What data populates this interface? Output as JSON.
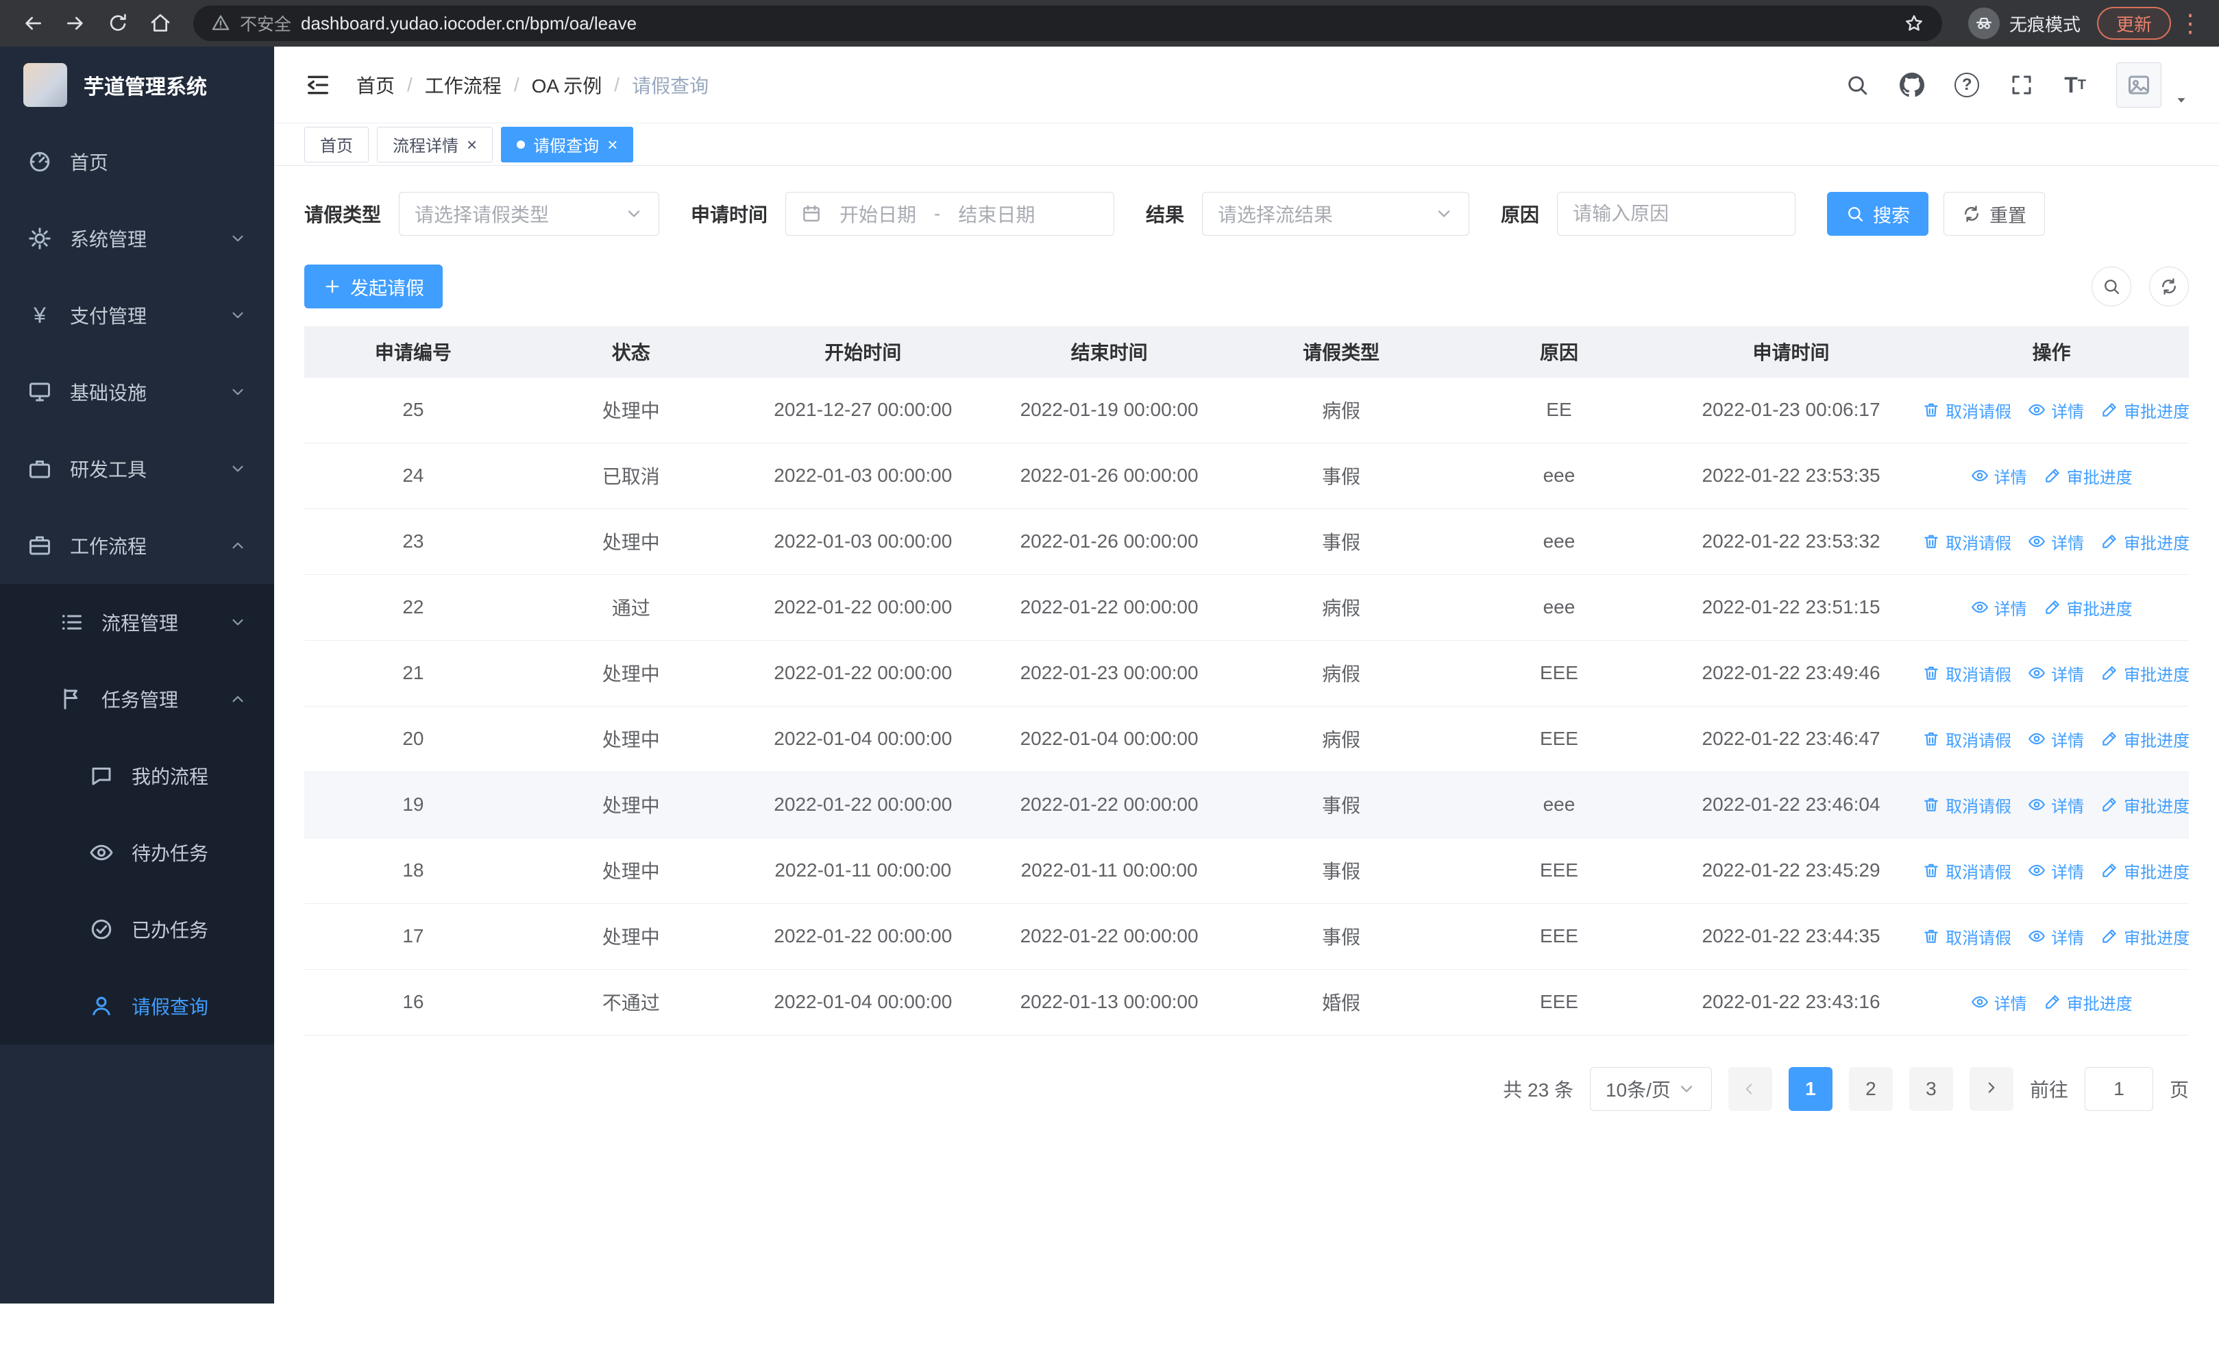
{
  "browser": {
    "security_warning": "不安全",
    "url": "dashboard.yudao.iocoder.cn/bpm/oa/leave",
    "incognito_label": "无痕模式",
    "update_label": "更新"
  },
  "sidebar": {
    "logo_title": "芋道管理系统",
    "items": [
      {
        "label": "首页"
      },
      {
        "label": "系统管理"
      },
      {
        "label": "支付管理"
      },
      {
        "label": "基础设施"
      },
      {
        "label": "研发工具"
      },
      {
        "label": "工作流程"
      },
      {
        "label": "流程管理"
      },
      {
        "label": "任务管理"
      },
      {
        "label": "我的流程"
      },
      {
        "label": "待办任务"
      },
      {
        "label": "已办任务"
      },
      {
        "label": "请假查询"
      }
    ]
  },
  "breadcrumb": {
    "items": [
      "首页",
      "工作流程",
      "OA 示例",
      "请假查询"
    ]
  },
  "tabs": [
    {
      "label": "首页"
    },
    {
      "label": "流程详情"
    },
    {
      "label": "请假查询"
    }
  ],
  "filters": {
    "leave_type_label": "请假类型",
    "leave_type_placeholder": "请选择请假类型",
    "apply_time_label": "申请时间",
    "start_date_placeholder": "开始日期",
    "range_separator": "-",
    "end_date_placeholder": "结束日期",
    "result_label": "结果",
    "result_placeholder": "请选择流结果",
    "reason_label": "原因",
    "reason_placeholder": "请输入原因",
    "search_label": "搜索",
    "reset_label": "重置"
  },
  "toolbar": {
    "create_label": "发起请假"
  },
  "table": {
    "columns": [
      "申请编号",
      "状态",
      "开始时间",
      "结束时间",
      "请假类型",
      "原因",
      "申请时间",
      "操作"
    ],
    "actions": {
      "cancel": "取消请假",
      "detail": "详情",
      "progress": "审批进度"
    },
    "rows": [
      {
        "id": "25",
        "status": "处理中",
        "start": "2021-12-27 00:00:00",
        "end": "2022-01-19 00:00:00",
        "type": "病假",
        "reason": "EE",
        "applied": "2022-01-23 00:06:17",
        "cancelable": true,
        "hover": false
      },
      {
        "id": "24",
        "status": "已取消",
        "start": "2022-01-03 00:00:00",
        "end": "2022-01-26 00:00:00",
        "type": "事假",
        "reason": "eee",
        "applied": "2022-01-22 23:53:35",
        "cancelable": false,
        "hover": false
      },
      {
        "id": "23",
        "status": "处理中",
        "start": "2022-01-03 00:00:00",
        "end": "2022-01-26 00:00:00",
        "type": "事假",
        "reason": "eee",
        "applied": "2022-01-22 23:53:32",
        "cancelable": true,
        "hover": false
      },
      {
        "id": "22",
        "status": "通过",
        "start": "2022-01-22 00:00:00",
        "end": "2022-01-22 00:00:00",
        "type": "病假",
        "reason": "eee",
        "applied": "2022-01-22 23:51:15",
        "cancelable": false,
        "hover": false
      },
      {
        "id": "21",
        "status": "处理中",
        "start": "2022-01-22 00:00:00",
        "end": "2022-01-23 00:00:00",
        "type": "病假",
        "reason": "EEE",
        "applied": "2022-01-22 23:49:46",
        "cancelable": true,
        "hover": false
      },
      {
        "id": "20",
        "status": "处理中",
        "start": "2022-01-04 00:00:00",
        "end": "2022-01-04 00:00:00",
        "type": "病假",
        "reason": "EEE",
        "applied": "2022-01-22 23:46:47",
        "cancelable": true,
        "hover": false
      },
      {
        "id": "19",
        "status": "处理中",
        "start": "2022-01-22 00:00:00",
        "end": "2022-01-22 00:00:00",
        "type": "事假",
        "reason": "eee",
        "applied": "2022-01-22 23:46:04",
        "cancelable": true,
        "hover": true
      },
      {
        "id": "18",
        "status": "处理中",
        "start": "2022-01-11 00:00:00",
        "end": "2022-01-11 00:00:00",
        "type": "事假",
        "reason": "EEE",
        "applied": "2022-01-22 23:45:29",
        "cancelable": true,
        "hover": false
      },
      {
        "id": "17",
        "status": "处理中",
        "start": "2022-01-22 00:00:00",
        "end": "2022-01-22 00:00:00",
        "type": "事假",
        "reason": "EEE",
        "applied": "2022-01-22 23:44:35",
        "cancelable": true,
        "hover": false
      },
      {
        "id": "16",
        "status": "不通过",
        "start": "2022-01-04 00:00:00",
        "end": "2022-01-13 00:00:00",
        "type": "婚假",
        "reason": "EEE",
        "applied": "2022-01-22 23:43:16",
        "cancelable": false,
        "hover": false
      }
    ]
  },
  "pagination": {
    "total_label": "共 23 条",
    "page_size": "10条/页",
    "pages": [
      "1",
      "2",
      "3"
    ],
    "active_page": "1",
    "goto_label": "前往",
    "goto_value": "1",
    "goto_suffix": "页"
  },
  "colors": {
    "primary": "#409eff",
    "sidebar_bg": "#202a3a",
    "browser_bar_bg": "#35363a",
    "table_header_bg": "#f0f2f5"
  }
}
